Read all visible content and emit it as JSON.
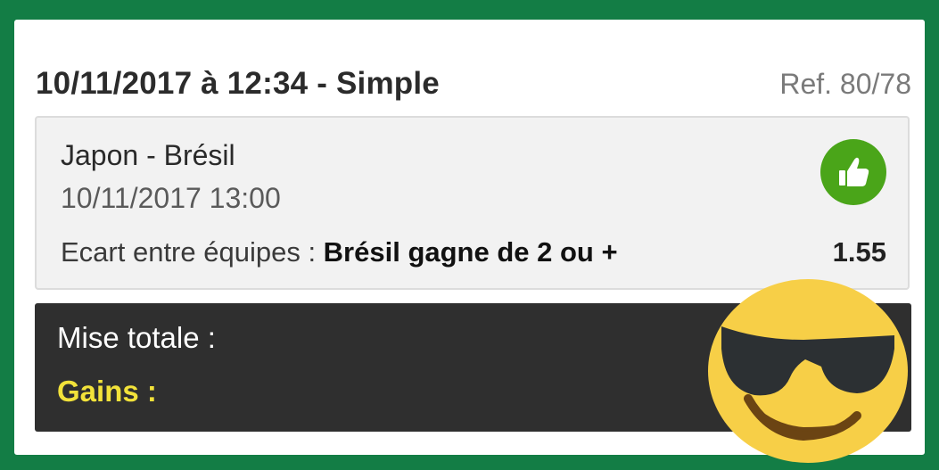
{
  "header": {
    "datetime": "10/11/2017 à 12:34 - Simple",
    "ref": "Ref. 80/78"
  },
  "bet": {
    "match": "Japon - Brésil",
    "match_datetime": "10/11/2017 13:00",
    "market_label": "Ecart entre équipes : ",
    "selection": "Brésil gagne de 2 ou +",
    "odds": "1.55",
    "status_icon": "thumbs-up-icon"
  },
  "summary": {
    "stake_label": "Mise totale :",
    "gains_label": "Gains :"
  },
  "overlay": {
    "emoji": "sunglasses-smiley-emoji"
  },
  "colors": {
    "background": "#137d45",
    "card": "#ffffff",
    "bet_box": "#f2f2f2",
    "won_icon": "#4aa519",
    "summary_bar": "#2f2f2f",
    "gains_text": "#f2e23a",
    "emoji_face": "#f7cf47"
  }
}
